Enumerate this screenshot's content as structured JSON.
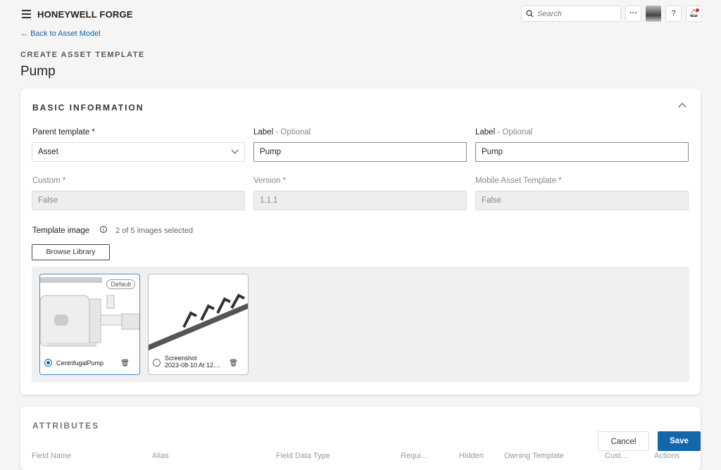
{
  "header": {
    "brand": "HONEYWELL FORGE",
    "search_placeholder": "Search",
    "more": "···"
  },
  "nav": {
    "back": "Back to Asset Model"
  },
  "page": {
    "subtitle": "CREATE ASSET TEMPLATE",
    "title": "Pump"
  },
  "basic": {
    "title": "BASIC INFORMATION",
    "parent_label": "Parent template",
    "parent_value": "Asset",
    "label1": "Label",
    "label1_opt": "- Optional",
    "label1_value": "Pump",
    "label2": "Label",
    "label2_opt": "- Optional",
    "label2_value": "Pump",
    "custom_label": "Custom",
    "custom_value": "False",
    "version_label": "Version",
    "version_value": "1.1.1",
    "mobile_label": "Mobile Asset Template",
    "mobile_value": "False",
    "required": "*",
    "image_label": "Template image",
    "image_count": "2 of 5 images selected",
    "browse": "Browse Library",
    "images": [
      {
        "name": "CentrifugalPump",
        "badge": "Default",
        "selected": true
      },
      {
        "name_line1": "Screenshot",
        "name_line2": "2023-08-10 At 12....",
        "selected": false
      }
    ]
  },
  "attributes": {
    "title": "ATTRIBUTES",
    "columns": [
      "Field Name",
      "Alias",
      "Field Data Type",
      "Requi...",
      "Hidden",
      "Owning Template",
      "Cust...",
      "Actions"
    ]
  },
  "footer": {
    "cancel": "Cancel",
    "save": "Save"
  },
  "colors": {
    "accent": "#1466a8",
    "notification": "#e02020"
  }
}
